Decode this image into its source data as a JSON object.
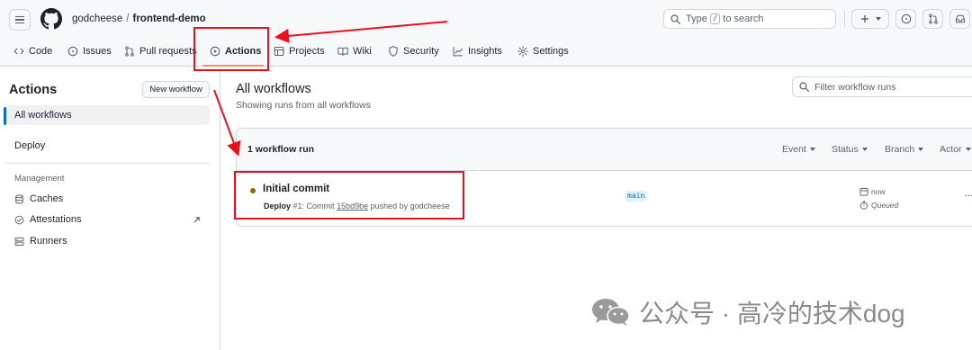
{
  "header": {
    "owner": "godcheese",
    "separator": "/",
    "repo": "frontend-demo",
    "search": {
      "prefix": "Type",
      "key": "/",
      "suffix": "to search"
    }
  },
  "tabs": [
    {
      "label": "Code",
      "icon": "code-icon"
    },
    {
      "label": "Issues",
      "icon": "issue-opened-icon"
    },
    {
      "label": "Pull requests",
      "icon": "git-pull-request-icon"
    },
    {
      "label": "Actions",
      "icon": "play-icon",
      "active": true
    },
    {
      "label": "Projects",
      "icon": "table-icon"
    },
    {
      "label": "Wiki",
      "icon": "book-icon"
    },
    {
      "label": "Security",
      "icon": "shield-icon"
    },
    {
      "label": "Insights",
      "icon": "graph-icon"
    },
    {
      "label": "Settings",
      "icon": "gear-icon"
    }
  ],
  "sidebar": {
    "title": "Actions",
    "new_workflow": "New workflow",
    "items": [
      {
        "label": "All workflows",
        "selected": true
      },
      {
        "label": "Deploy"
      }
    ],
    "management_label": "Management",
    "management": [
      {
        "label": "Caches",
        "icon": "database-icon"
      },
      {
        "label": "Attestations",
        "icon": "verified-icon"
      },
      {
        "label": "Runners",
        "icon": "server-icon"
      }
    ]
  },
  "main": {
    "title": "All workflows",
    "subtitle": "Showing runs from all workflows",
    "filter_placeholder": "Filter workflow runs",
    "runs_count": "1 workflow run",
    "filters": [
      "Event",
      "Status",
      "Branch",
      "Actor"
    ]
  },
  "run": {
    "title": "Initial commit",
    "workflow": "Deploy",
    "number": "#1: Commit",
    "sha": "15bd9be",
    "pushed_by": "pushed by godcheese",
    "branch": "main",
    "time": "now",
    "status": "Queued",
    "status_color": "#9a6700"
  },
  "annotation_color": "#e8101a",
  "watermark": "公众号 · 高冷的技术dog"
}
